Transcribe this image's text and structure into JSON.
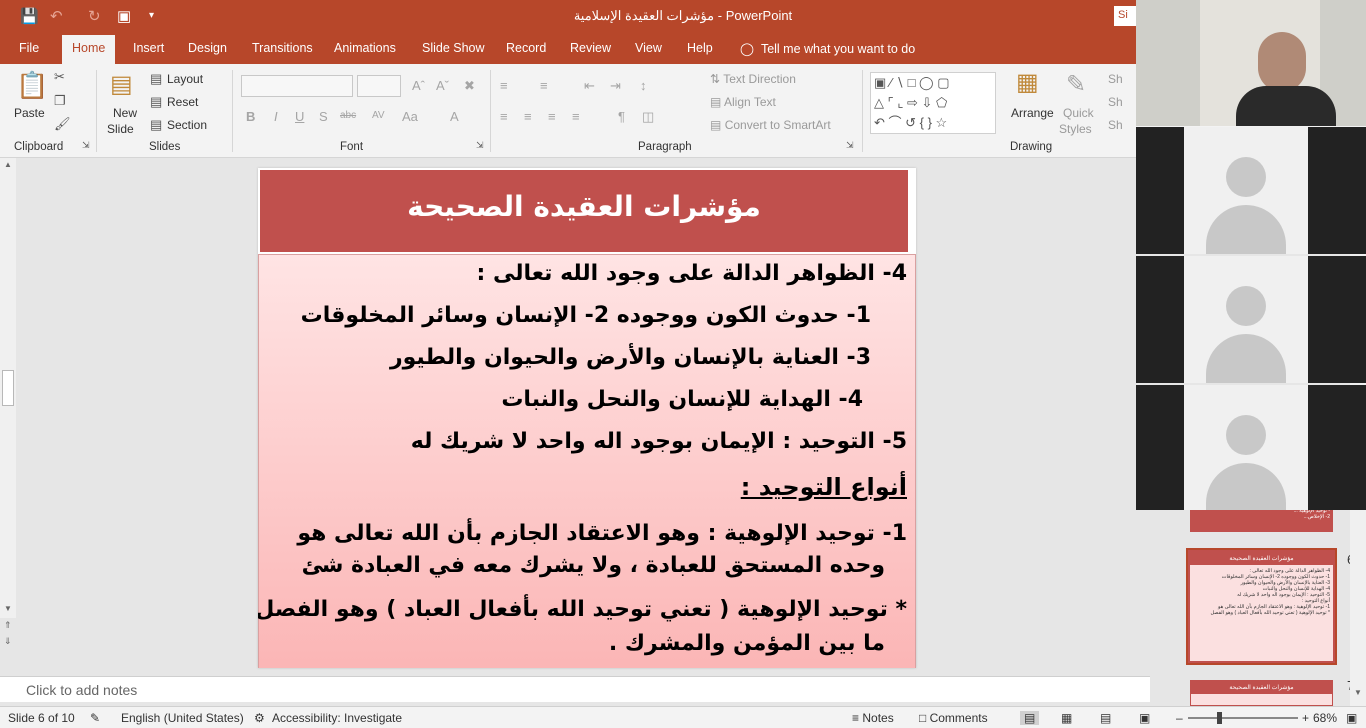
{
  "window": {
    "title": "مؤشرات العقيدة الإسلامية  -  PowerPoint",
    "signin_label": "Si"
  },
  "ribbon_tabs": [
    "File",
    "Home",
    "Insert",
    "Design",
    "Transitions",
    "Animations",
    "Slide Show",
    "Record",
    "Review",
    "View",
    "Help"
  ],
  "tell_me": "Tell me what you want to do",
  "ribbon": {
    "clipboard": {
      "paste": "Paste",
      "label": "Clipboard"
    },
    "slides": {
      "new_slide_1": "New",
      "new_slide_2": "Slide",
      "layout": "Layout",
      "reset": "Reset",
      "section": "Section",
      "label": "Slides"
    },
    "font": {
      "label": "Font",
      "bold": "B",
      "italic": "I",
      "underline": "U",
      "shadow": "S",
      "strike": "abc",
      "spacing": "AV",
      "case": "Aa",
      "color": "A"
    },
    "paragraph": {
      "label": "Paragraph",
      "text_direction": "Text Direction",
      "align_text": "Align Text",
      "smartart": "Convert to SmartArt"
    },
    "drawing": {
      "label": "Drawing",
      "arrange": "Arrange",
      "quick_styles_1": "Quick",
      "quick_styles_2": "Styles",
      "shape_fill": "Sh",
      "shape_outline": "Sh",
      "shape_effects": "Sh"
    }
  },
  "slide": {
    "title": "مؤشرات العقيدة الصحيحة",
    "lines": [
      "4- الظواهر الدالة على وجود الله تعالى :",
      "1- حدوث الكون ووجوده   2- الإنسان وسائر المخلوقات",
      "3- العناية بالإنسان والأرض والحيوان والطيور",
      "4- الهداية للإنسان والنحل والنبات",
      "5- التوحيد : الإيمان بوجود اله واحد لا شريك له",
      "أنواع التوحيد :",
      "1- توحيد الإلوهية : وهو الاعتقاد الجازم بأن الله تعالى هو",
      "وحده المستحق للعبادة ، ولا يشرك معه في العبادة شئ",
      "* توحيد الإلوهية ( تعني توحيد الله بأفعال العباد ) وهو الفصل",
      "ما بين المؤمن والمشرك ."
    ]
  },
  "notes_placeholder": "Click to add notes",
  "thumbnails": {
    "numbers": [
      "6",
      "7"
    ],
    "slide6_title": "مؤشرات العقيدة الصحيحة",
    "slide7_title": "مؤشرات العقيدة الصحيحة",
    "slide5_lines": [
      "- توحيد الإلوهية ...",
      "2- الإخلاص..."
    ]
  },
  "status": {
    "slide_of": "Slide 6 of 10",
    "language": "English (United States)",
    "accessibility": "Accessibility: Investigate",
    "notes": "Notes",
    "comments": "Comments",
    "zoom": "68%"
  }
}
